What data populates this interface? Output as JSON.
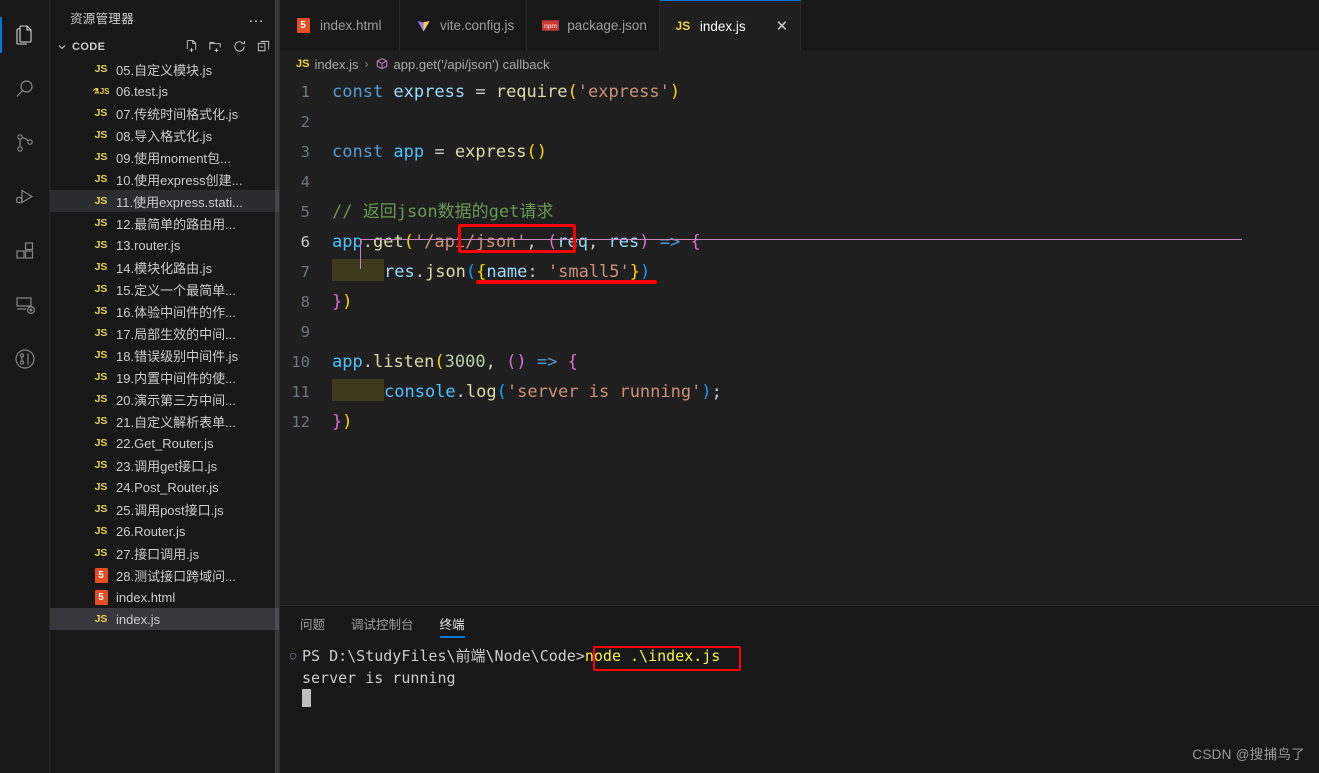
{
  "activitybar": {
    "items": [
      {
        "name": "explorer",
        "icon": "files-icon",
        "active": true
      },
      {
        "name": "search",
        "icon": "search-icon",
        "active": false
      },
      {
        "name": "source-control",
        "icon": "source-control-icon",
        "active": false
      },
      {
        "name": "run-and-debug",
        "icon": "run-debug-icon",
        "active": false
      },
      {
        "name": "extensions",
        "icon": "extensions-icon",
        "active": false
      },
      {
        "name": "remote-explorer",
        "icon": "remote-explorer-icon",
        "active": false
      },
      {
        "name": "gitlens",
        "icon": "gitlens-icon",
        "active": false
      }
    ]
  },
  "sidebar": {
    "title": "资源管理器",
    "more_actions": "…",
    "section": {
      "label": "CODE",
      "chevron": "⌄",
      "actions": [
        {
          "name": "new-file",
          "label": "新建文件"
        },
        {
          "name": "new-folder",
          "label": "新建文件夹"
        },
        {
          "name": "refresh-explorer",
          "label": "刷新"
        },
        {
          "name": "collapse-folders",
          "label": "全部折叠"
        }
      ]
    },
    "files": [
      {
        "name": "05.自定义模块.js",
        "icon": "js",
        "state": ""
      },
      {
        "name": "06.test.js",
        "icon": "jstest",
        "state": ""
      },
      {
        "name": "07.传统时间格式化.js",
        "icon": "js",
        "state": ""
      },
      {
        "name": "08.导入格式化.js",
        "icon": "js",
        "state": ""
      },
      {
        "name": "09.使用moment包...",
        "icon": "js",
        "state": ""
      },
      {
        "name": "10.使用express创建...",
        "icon": "js",
        "state": ""
      },
      {
        "name": "11.使用express.stati...",
        "icon": "js",
        "state": "selected"
      },
      {
        "name": "12.最简单的路由用...",
        "icon": "js",
        "state": ""
      },
      {
        "name": "13.router.js",
        "icon": "js",
        "state": ""
      },
      {
        "name": "14.模块化路由.js",
        "icon": "js",
        "state": ""
      },
      {
        "name": "15.定义一个最简单...",
        "icon": "js",
        "state": ""
      },
      {
        "name": "16.体验中间件的作...",
        "icon": "js",
        "state": ""
      },
      {
        "name": "17.局部生效的中间...",
        "icon": "js",
        "state": ""
      },
      {
        "name": "18.错误级别中间件.js",
        "icon": "js",
        "state": ""
      },
      {
        "name": "19.内置中间件的使...",
        "icon": "js",
        "state": ""
      },
      {
        "name": "20.演示第三方中间...",
        "icon": "js",
        "state": ""
      },
      {
        "name": "21.自定义解析表单...",
        "icon": "js",
        "state": ""
      },
      {
        "name": "22.Get_Router.js",
        "icon": "js",
        "state": ""
      },
      {
        "name": "23.调用get接口.js",
        "icon": "js",
        "state": ""
      },
      {
        "name": "24.Post_Router.js",
        "icon": "js",
        "state": ""
      },
      {
        "name": "25.调用post接口.js",
        "icon": "js",
        "state": ""
      },
      {
        "name": "26.Router.js",
        "icon": "js",
        "state": ""
      },
      {
        "name": "27.接口调用.js",
        "icon": "js",
        "state": ""
      },
      {
        "name": "28.测试接口跨域问...",
        "icon": "html",
        "state": ""
      },
      {
        "name": "index.html",
        "icon": "html",
        "state": ""
      },
      {
        "name": "index.js",
        "icon": "js",
        "state": "focused"
      }
    ]
  },
  "tabs": [
    {
      "label": "index.html",
      "icon": "html5-icon",
      "active": false,
      "closable": false
    },
    {
      "label": "vite.config.js",
      "icon": "vite-icon",
      "active": false,
      "closable": false
    },
    {
      "label": "package.json",
      "icon": "npm-icon",
      "active": false,
      "closable": false
    },
    {
      "label": "index.js",
      "icon": "js-icon",
      "active": true,
      "closable": true,
      "close": "✕"
    }
  ],
  "breadcrumb": {
    "file": "index.js",
    "separator": "›",
    "symbol": "app.get('/api/json') callback",
    "file_icon": "JS",
    "symbol_icon": "cube-icon"
  },
  "editor": {
    "lines": [
      {
        "n": "1",
        "tokens": [
          {
            "t": "const ",
            "c": "t-key"
          },
          {
            "t": "express",
            "c": "t-var"
          },
          {
            "t": " ",
            "c": "t-plain"
          },
          {
            "t": "=",
            "c": "t-plain"
          },
          {
            "t": " ",
            "c": "t-plain"
          },
          {
            "t": "require",
            "c": "t-fn"
          },
          {
            "t": "(",
            "c": "p-gold"
          },
          {
            "t": "'express'",
            "c": "t-str"
          },
          {
            "t": ")",
            "c": "p-gold"
          }
        ]
      },
      {
        "n": "2",
        "tokens": []
      },
      {
        "n": "3",
        "tokens": [
          {
            "t": "const ",
            "c": "t-key"
          },
          {
            "t": "app",
            "c": "t-varb"
          },
          {
            "t": " ",
            "c": "t-plain"
          },
          {
            "t": "=",
            "c": "t-plain"
          },
          {
            "t": " ",
            "c": "t-plain"
          },
          {
            "t": "express",
            "c": "t-fn"
          },
          {
            "t": "(",
            "c": "p-gold"
          },
          {
            "t": ")",
            "c": "p-gold"
          }
        ]
      },
      {
        "n": "4",
        "tokens": []
      },
      {
        "n": "5",
        "tokens": [
          {
            "t": "// 返回json数据的get请求",
            "c": "t-com"
          }
        ]
      },
      {
        "n": "6",
        "active": true,
        "tokens": [
          {
            "t": "app",
            "c": "t-varb"
          },
          {
            "t": ".",
            "c": "t-plain"
          },
          {
            "t": "get",
            "c": "t-fn"
          },
          {
            "t": "(",
            "c": "p-gold"
          },
          {
            "t": "'/api/json'",
            "c": "t-str"
          },
          {
            "t": ",",
            "c": "t-plain"
          },
          {
            "t": " ",
            "c": "t-plain"
          },
          {
            "t": "(",
            "c": "p-pink"
          },
          {
            "t": "req",
            "c": "t-var"
          },
          {
            "t": ",",
            "c": "t-plain"
          },
          {
            "t": " ",
            "c": "t-plain"
          },
          {
            "t": "res",
            "c": "t-var"
          },
          {
            "t": ")",
            "c": "p-pink"
          },
          {
            "t": " ",
            "c": "t-plain"
          },
          {
            "t": "=>",
            "c": "t-arrow"
          },
          {
            "t": " ",
            "c": "t-plain"
          },
          {
            "t": "{",
            "c": "p-pink"
          }
        ]
      },
      {
        "n": "7",
        "indent": true,
        "tokens": [
          {
            "t": "res",
            "c": "t-var"
          },
          {
            "t": ".",
            "c": "t-plain"
          },
          {
            "t": "json",
            "c": "t-fn"
          },
          {
            "t": "(",
            "c": "p-blue"
          },
          {
            "t": "{",
            "c": "p-gold"
          },
          {
            "t": "name",
            "c": "t-var"
          },
          {
            "t": ":",
            "c": "t-plain"
          },
          {
            "t": " ",
            "c": "t-plain"
          },
          {
            "t": "'small5'",
            "c": "t-str"
          },
          {
            "t": "}",
            "c": "p-gold"
          },
          {
            "t": ")",
            "c": "p-blue"
          }
        ]
      },
      {
        "n": "8",
        "tokens": [
          {
            "t": "}",
            "c": "p-pink"
          },
          {
            "t": ")",
            "c": "p-gold"
          }
        ]
      },
      {
        "n": "9",
        "tokens": []
      },
      {
        "n": "10",
        "tokens": [
          {
            "t": "app",
            "c": "t-varb"
          },
          {
            "t": ".",
            "c": "t-plain"
          },
          {
            "t": "listen",
            "c": "t-fn"
          },
          {
            "t": "(",
            "c": "p-gold"
          },
          {
            "t": "3000",
            "c": "t-num"
          },
          {
            "t": ",",
            "c": "t-plain"
          },
          {
            "t": " ",
            "c": "t-plain"
          },
          {
            "t": "(",
            "c": "p-pink"
          },
          {
            "t": ")",
            "c": "p-pink"
          },
          {
            "t": " ",
            "c": "t-plain"
          },
          {
            "t": "=>",
            "c": "t-arrow"
          },
          {
            "t": " ",
            "c": "t-plain"
          },
          {
            "t": "{",
            "c": "p-pink"
          }
        ]
      },
      {
        "n": "11",
        "indent": true,
        "tokens": [
          {
            "t": "console",
            "c": "t-varb"
          },
          {
            "t": ".",
            "c": "t-plain"
          },
          {
            "t": "log",
            "c": "t-fn"
          },
          {
            "t": "(",
            "c": "p-blue"
          },
          {
            "t": "'server is running'",
            "c": "t-str"
          },
          {
            "t": ")",
            "c": "p-blue"
          },
          {
            "t": ";",
            "c": "t-plain"
          }
        ]
      },
      {
        "n": "12",
        "tokens": [
          {
            "t": "}",
            "c": "p-pink"
          },
          {
            "t": ")",
            "c": "p-gold"
          }
        ]
      }
    ],
    "annotations": {
      "route_box_label": "'/api/json'",
      "json_underline_label": "{name: 'small5'}"
    }
  },
  "panel": {
    "tabs": [
      {
        "label": "问题",
        "active": false
      },
      {
        "label": "调试控制台",
        "active": false
      },
      {
        "label": "终端",
        "active": true
      }
    ],
    "terminal": {
      "gutter_marker": "○",
      "prompt": "PS D:\\StudyFiles\\前端\\Node\\Code>",
      "command": "node .\\index.js",
      "output": "server is running"
    }
  },
  "watermark": "CSDN @搜捕鸟了",
  "colors": {
    "accent": "#0078D4",
    "annotation_red": "#FF0000",
    "editor_bg": "#1F1F1F",
    "chrome_bg": "#181818",
    "terminal_cmd": "#F5F543"
  }
}
